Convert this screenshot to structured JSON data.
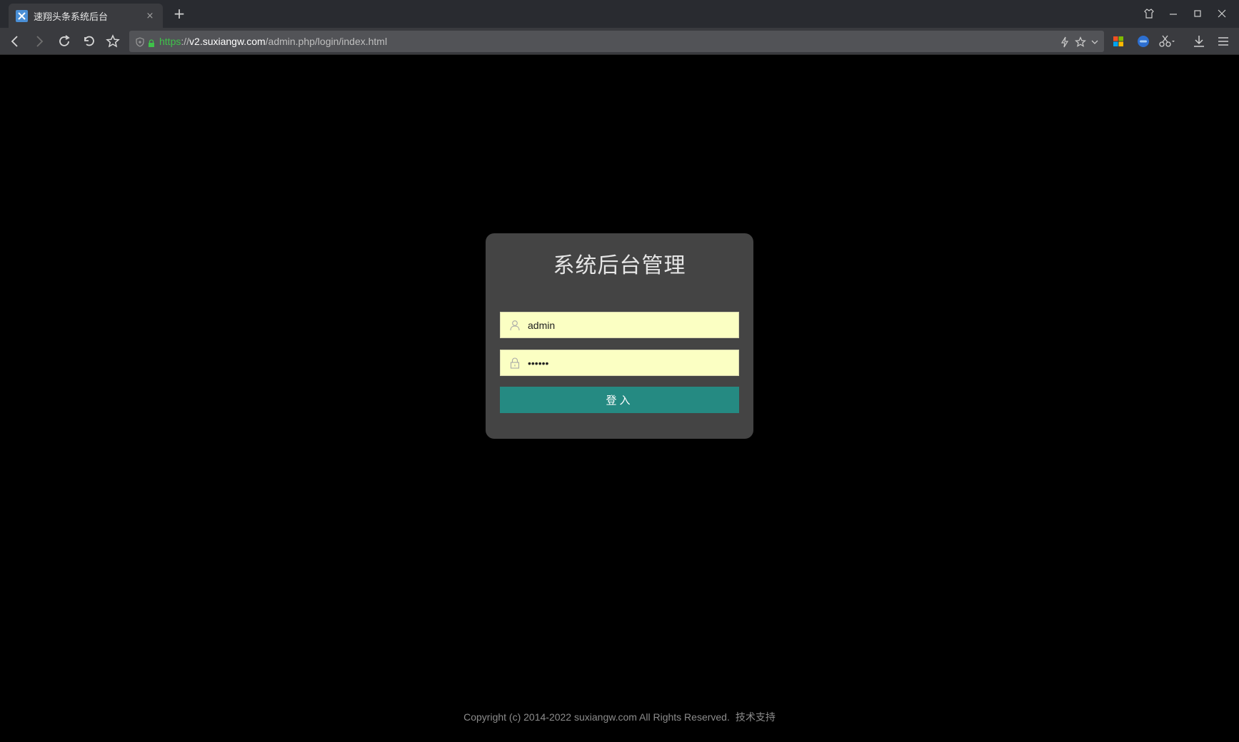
{
  "browser": {
    "tab": {
      "title": "速翔头条系统后台",
      "close_label": "×"
    },
    "new_tab_label": "+",
    "url": {
      "scheme": "https",
      "separator": "://",
      "host": "v2.suxiangw.com",
      "path": "/admin.php/login/index.html"
    }
  },
  "login": {
    "title": "系统后台管理",
    "username": {
      "value": "admin"
    },
    "password": {
      "value": "••••••"
    },
    "submit_label": "登入"
  },
  "footer": {
    "copyright": "Copyright (c) 2014-2022 suxiangw.com All Rights Reserved.",
    "support_link": "技术支持"
  },
  "colors": {
    "card_bg": "#444444",
    "input_bg": "#fbffc3",
    "button_bg": "#258a82",
    "page_bg": "#000000",
    "url_scheme": "#3fc24a"
  },
  "icons": [
    "favicon-icon",
    "back-icon",
    "forward-icon",
    "reload-icon",
    "undo-icon",
    "bookmark-star-icon",
    "shield-icon",
    "lock-icon",
    "lightning-icon",
    "star-icon",
    "chevron-down-icon",
    "apps-grid-icon",
    "extension-icon",
    "scissors-icon",
    "download-icon",
    "menu-icon",
    "skin-icon",
    "minimize-icon",
    "maximize-icon",
    "close-icon",
    "user-icon",
    "padlock-icon"
  ]
}
